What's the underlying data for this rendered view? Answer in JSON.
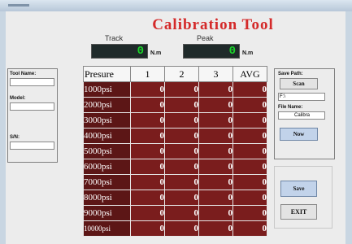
{
  "app": {
    "title": "Calibration Tool"
  },
  "gauges": {
    "track": {
      "label": "Track",
      "value": "0",
      "unit": "N.m"
    },
    "peak": {
      "label": "Peak",
      "value": "0",
      "unit": "N.m"
    }
  },
  "left_panel": {
    "tool_name_label": "Tool Name:",
    "tool_name_value": "",
    "model_label": "Model:",
    "model_value": "",
    "sn_label": "S/N:",
    "sn_value": ""
  },
  "right_panel": {
    "save_path_label": "Save Path:",
    "scan_button": "Scan",
    "path_value": "F:\\",
    "file_name_label": "File Name:",
    "file_name_value": "Calibra",
    "now_button": "Now"
  },
  "actions": {
    "save_button": "Save",
    "exit_button": "EXIT"
  },
  "table": {
    "headers": [
      "Presure",
      "1",
      "2",
      "3",
      "AVG"
    ],
    "rows": [
      {
        "label": "1000psi",
        "values": [
          "0",
          "0",
          "0",
          "0"
        ]
      },
      {
        "label": "2000psi",
        "values": [
          "0",
          "0",
          "0",
          "0"
        ]
      },
      {
        "label": "3000psi",
        "values": [
          "0",
          "0",
          "0",
          "0"
        ]
      },
      {
        "label": "4000psi",
        "values": [
          "0",
          "0",
          "0",
          "0"
        ]
      },
      {
        "label": "5000psi",
        "values": [
          "0",
          "0",
          "0",
          "0"
        ]
      },
      {
        "label": "6000psi",
        "values": [
          "0",
          "0",
          "0",
          "0"
        ]
      },
      {
        "label": "7000psi",
        "values": [
          "0",
          "0",
          "0",
          "0"
        ]
      },
      {
        "label": "8000psi",
        "values": [
          "0",
          "0",
          "0",
          "0"
        ]
      },
      {
        "label": "9000psi",
        "values": [
          "0",
          "0",
          "0",
          "0"
        ]
      },
      {
        "label": "10000psi",
        "values": [
          "0",
          "0",
          "0",
          "0"
        ]
      }
    ]
  },
  "colors": {
    "title": "#d42a2a",
    "gauge_digits": "#1bd52a",
    "cell_bg": "#7a1d1d",
    "row_head_bg": "#5c1616"
  }
}
